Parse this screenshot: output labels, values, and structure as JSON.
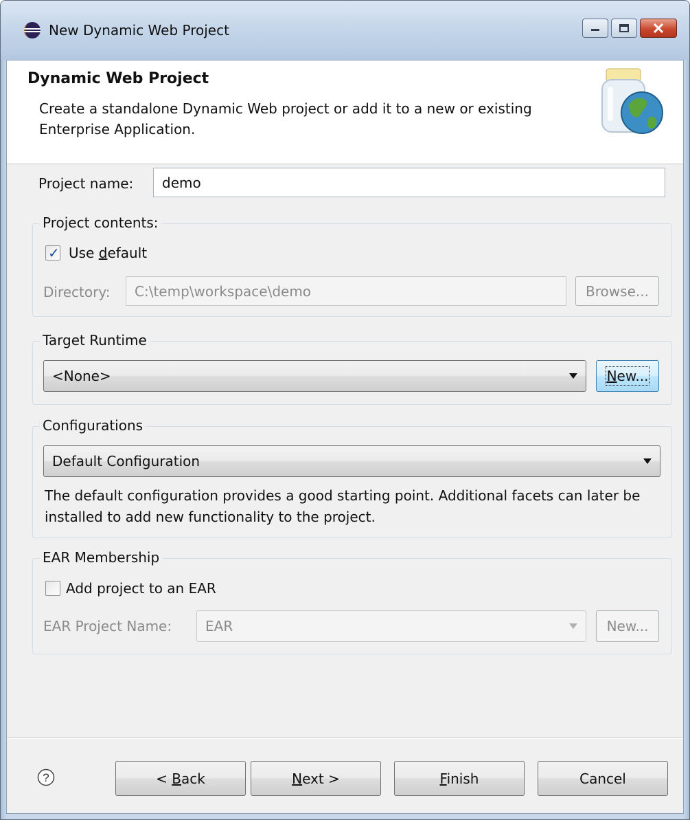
{
  "window": {
    "title": "New Dynamic Web Project",
    "icon": "eclipse-icon",
    "controls": [
      "minimize-icon",
      "maximize-icon",
      "close-icon"
    ]
  },
  "banner": {
    "title": "Dynamic Web Project",
    "description": "Create a standalone Dynamic Web project or add it to a new or existing Enterprise Application.",
    "icon": "web-project-jar-icon"
  },
  "project_name": {
    "label": "Project name:",
    "value": "demo"
  },
  "project_contents": {
    "title": "Project contents:",
    "use_default_label": "Use default",
    "use_default_checked": true,
    "directory_label": "Directory:",
    "directory_value": "C:\\temp\\workspace\\demo",
    "browse_label": "Browse..."
  },
  "target_runtime": {
    "title": "Target Runtime",
    "selected": "<None>",
    "new_label": "New..."
  },
  "configurations": {
    "title": "Configurations",
    "selected": "Default Configuration",
    "description": "The default configuration provides a good starting point. Additional facets can later be installed to add new functionality to the project."
  },
  "ear_membership": {
    "title": "EAR Membership",
    "add_label": "Add project to an EAR",
    "add_checked": false,
    "ear_name_label": "EAR Project Name:",
    "ear_name_value": "EAR",
    "new_label": "New..."
  },
  "footer": {
    "help_icon": "help-icon",
    "back_label": "< Back",
    "next_label": "Next >",
    "finish_label": "Finish",
    "cancel_label": "Cancel"
  },
  "colors": {
    "titlebar": "#c6d7ea",
    "dialog_bg": "#f0f0f0",
    "focus_button": "#bee6fd",
    "disabled_text": "#8a8a8a"
  }
}
